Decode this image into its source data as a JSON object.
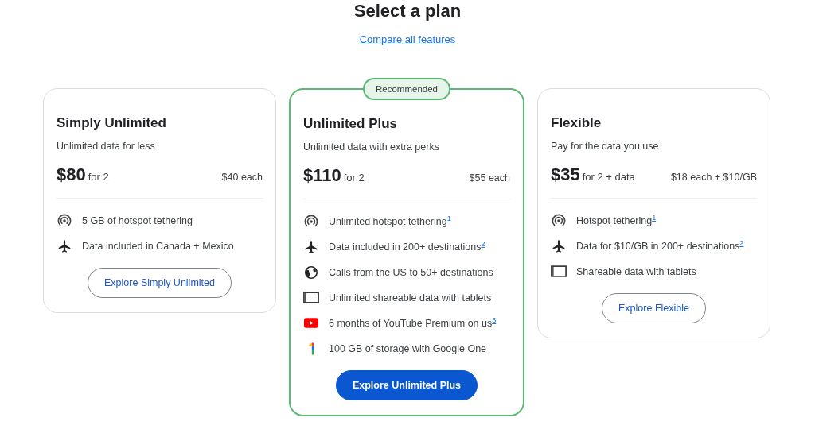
{
  "page": {
    "title": "Select a plan",
    "compare_link": "Compare all features"
  },
  "plans": [
    {
      "name": "Simply Unlimited",
      "tagline": "Unlimited data for less",
      "price": "$80",
      "price_note": "for 2",
      "per_line": "$40 each",
      "recommended": false,
      "features": [
        {
          "kind": "hotspot",
          "text": "5 GB of hotspot tethering"
        },
        {
          "kind": "plane",
          "text": "Data included in Canada + Mexico"
        }
      ],
      "button": {
        "label": "Explore Simply Unlimited",
        "kind": "outline"
      }
    },
    {
      "name": "Unlimited Plus",
      "badge": "Recommended",
      "tagline": "Unlimited data with extra perks",
      "price": "$110",
      "price_note": "for 2",
      "per_line": "$55 each",
      "recommended": true,
      "features": [
        {
          "kind": "hotspot",
          "text": "Unlimited hotspot tethering",
          "note": "1"
        },
        {
          "kind": "plane",
          "text": "Data included in 200+ destinations",
          "note": "2"
        },
        {
          "kind": "globe",
          "text": "Calls from the US to 50+ destinations"
        },
        {
          "kind": "tablet",
          "text": "Unlimited shareable data with tablets"
        },
        {
          "kind": "video",
          "text": "6 months of YouTube Premium on us",
          "note": "3"
        },
        {
          "kind": "one",
          "text": "100 GB of storage with Google One"
        }
      ],
      "button": {
        "label": "Explore Unlimited Plus",
        "kind": "filled"
      }
    },
    {
      "name": "Flexible",
      "tagline": "Pay for the data you use",
      "price": "$35",
      "price_note": "for 2 + data",
      "per_line": "$18 each + $10/GB",
      "recommended": false,
      "features": [
        {
          "kind": "hotspot",
          "text": "Hotspot tethering",
          "note": "1"
        },
        {
          "kind": "plane",
          "text": "Data for $10/GB in 200+ destinations",
          "note": "2"
        },
        {
          "kind": "tablet",
          "text": "Shareable data with tablets"
        }
      ],
      "button": {
        "label": "Explore Flexible",
        "kind": "outline"
      }
    }
  ]
}
